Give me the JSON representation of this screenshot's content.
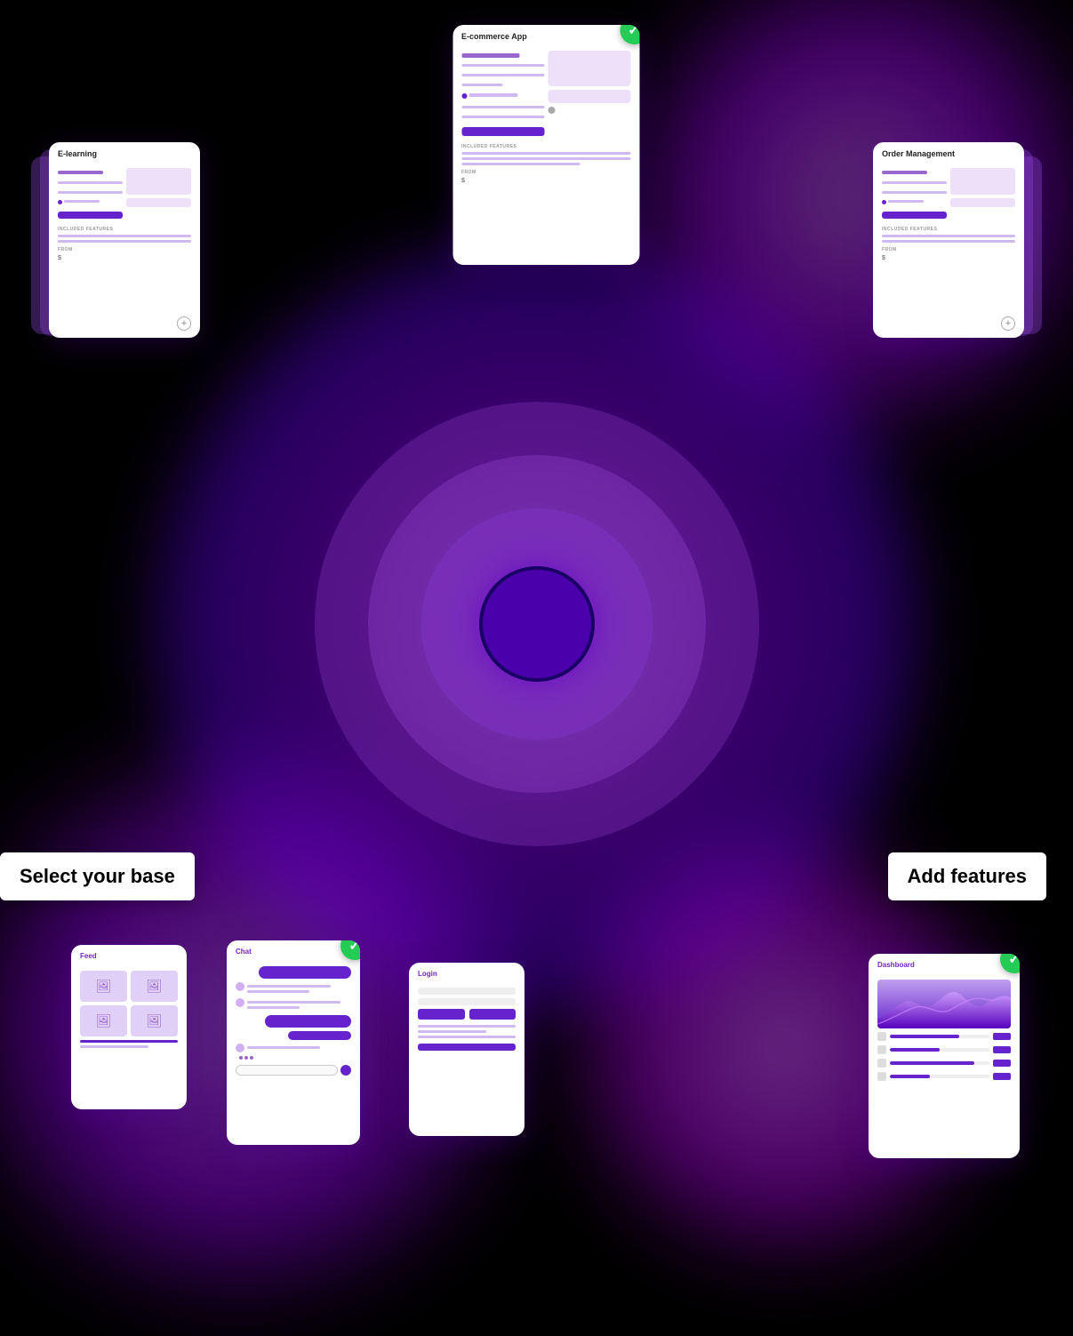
{
  "scene": {
    "background": "#000000",
    "labels": {
      "select_base": "Select your base",
      "add_features": "Add features"
    },
    "cards": {
      "ecommerce": {
        "title": "E-commerce App",
        "section_label": "INCLUDED FEATURES",
        "from_label": "FROM",
        "price": "$",
        "has_check": true
      },
      "elearning": {
        "title": "E-learning",
        "section_label": "INCLUDED FEATURES",
        "from_label": "FROM",
        "price": "$"
      },
      "order_management": {
        "title": "Order Management",
        "section_label": "INCLUDED FEATURES",
        "from_label": "FROM",
        "price": "$"
      },
      "feed": {
        "title": "Feed"
      },
      "chat": {
        "title": "Chat",
        "has_check": true
      },
      "login": {
        "title": "Login"
      },
      "dashboard": {
        "title": "Dashboard",
        "has_check": true
      }
    }
  }
}
